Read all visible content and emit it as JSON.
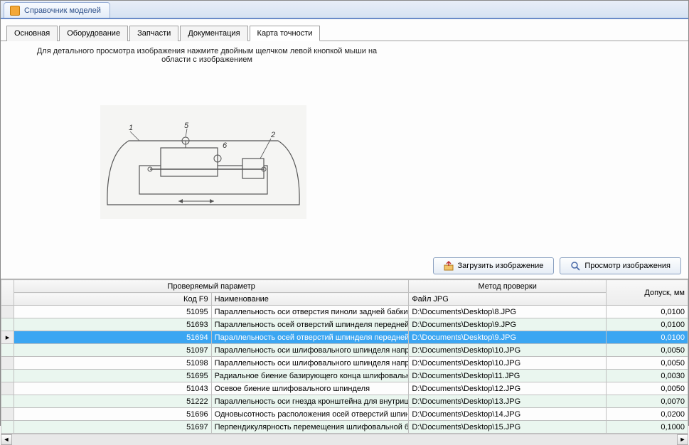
{
  "windowTabTitle": "Справочник моделей",
  "innerTabs": [
    {
      "label": "Основная",
      "active": false
    },
    {
      "label": "Оборудование",
      "active": false
    },
    {
      "label": "Запчасти",
      "active": false
    },
    {
      "label": "Документация",
      "active": false
    },
    {
      "label": "Карта точности",
      "active": true
    }
  ],
  "instruction": "Для детального просмотра изображения нажмите двойным щелчком левой кнопкой мыши на области с изображением",
  "buttons": {
    "load": "Загрузить изображение",
    "view": "Просмотр изображения"
  },
  "grid": {
    "header": {
      "group1": "Проверяемый параметр",
      "group2": "Метод проверки",
      "tol": "Допуск, мм",
      "code": "Код F9",
      "name": "Наименование",
      "file": "Файл JPG"
    },
    "rows": [
      {
        "code": "51095",
        "name": "Параллельность оси отверстия пиноли задней бабки направлению перемещ",
        "file": "D:\\Documents\\Desktop\\8.JPG",
        "tol": "0,0100",
        "sel": false
      },
      {
        "code": "51693",
        "name": "Параллельность осей отверстий шпинделя передней бабки и пиноли задне",
        "file": "D:\\Documents\\Desktop\\9.JPG",
        "tol": "0,0100",
        "sel": false
      },
      {
        "code": "51694",
        "name": "Параллельность осей отверстий шпинделя передней бабки и пиноли задне",
        "file": "D:\\Documents\\Desktop\\9.JPG",
        "tol": "0,0100",
        "sel": true
      },
      {
        "code": "51097",
        "name": "Параллельность оси шлифовального шпинделя направлению перемещения",
        "file": "D:\\Documents\\Desktop\\10.JPG",
        "tol": "0,0050",
        "sel": false
      },
      {
        "code": "51098",
        "name": "Параллельность оси шлифовального шпинделя направлению перемещения",
        "file": "D:\\Documents\\Desktop\\10.JPG",
        "tol": "0,0050",
        "sel": false
      },
      {
        "code": "51695",
        "name": "Радиальное биение базирующего конца шлифовального шпинделя под кру",
        "file": "D:\\Documents\\Desktop\\11.JPG",
        "tol": "0,0030",
        "sel": false
      },
      {
        "code": "51043",
        "name": "Осевое биение шлифовального шпинделя",
        "file": "D:\\Documents\\Desktop\\12.JPG",
        "tol": "0,0050",
        "sel": false
      },
      {
        "code": "51222",
        "name": "Параллельность оси гнезда кронштейна для внутришлифовального шпин",
        "file": "D:\\Documents\\Desktop\\13.JPG",
        "tol": "0,0070",
        "sel": false
      },
      {
        "code": "51696",
        "name": "Одновысотность расположения осей отверстий шпинделя передней бабки",
        "file": "D:\\Documents\\Desktop\\14.JPG",
        "tol": "0,0200",
        "sel": false
      },
      {
        "code": "51697",
        "name": "Перпендикулярность перемещения шлифовальной бабки направлению пер",
        "file": "D:\\Documents\\Desktop\\15.JPG",
        "tol": "0,1000",
        "sel": false
      }
    ]
  }
}
